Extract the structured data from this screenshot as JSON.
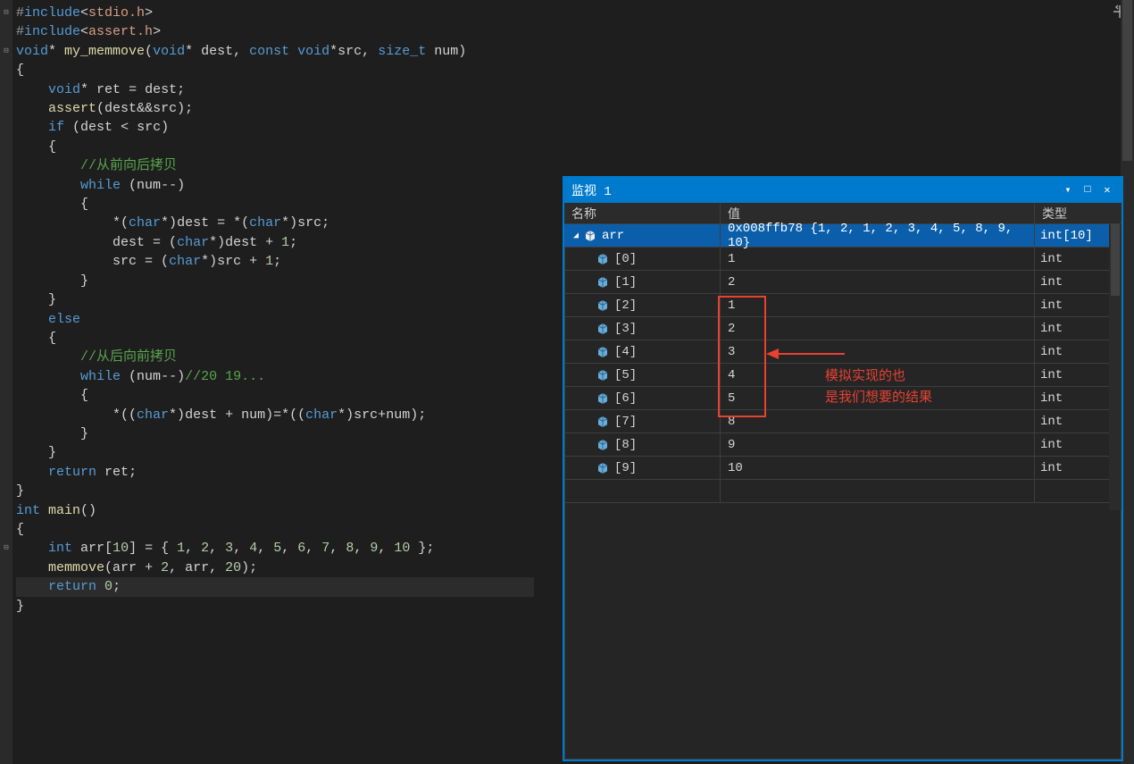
{
  "code_lines": [
    [
      [
        "preproc",
        "#"
      ],
      [
        "kw",
        "include"
      ],
      [
        "op",
        "<"
      ],
      [
        "lib",
        "stdio.h"
      ],
      [
        "op",
        ">"
      ]
    ],
    [
      [
        "preproc",
        "#"
      ],
      [
        "kw",
        "include"
      ],
      [
        "op",
        "<"
      ],
      [
        "lib",
        "assert.h"
      ],
      [
        "op",
        ">"
      ]
    ],
    [
      [
        "kw",
        "void"
      ],
      [
        "op",
        "* "
      ],
      [
        "fn",
        "my_memmove"
      ],
      [
        "op",
        "("
      ],
      [
        "kw",
        "void"
      ],
      [
        "op",
        "* "
      ],
      [
        "id",
        "dest"
      ],
      [
        "op",
        ", "
      ],
      [
        "kw",
        "const void"
      ],
      [
        "op",
        "*"
      ],
      [
        "id",
        "src"
      ],
      [
        "op",
        ", "
      ],
      [
        "kw",
        "size_t"
      ],
      [
        "id",
        " num"
      ],
      [
        "op",
        ")"
      ]
    ],
    [
      [
        "op",
        "{"
      ]
    ],
    [
      [
        "op",
        "    "
      ],
      [
        "kw",
        "void"
      ],
      [
        "op",
        "* "
      ],
      [
        "id",
        "ret"
      ],
      [
        "op",
        " = "
      ],
      [
        "id",
        "dest"
      ],
      [
        "op",
        ";"
      ]
    ],
    [
      [
        "op",
        "    "
      ],
      [
        "fn",
        "assert"
      ],
      [
        "op",
        "("
      ],
      [
        "id",
        "dest"
      ],
      [
        "op",
        "&&"
      ],
      [
        "id",
        "src"
      ],
      [
        "op",
        ");"
      ]
    ],
    [
      [
        "op",
        "    "
      ],
      [
        "kw",
        "if"
      ],
      [
        "op",
        " ("
      ],
      [
        "id",
        "dest"
      ],
      [
        "op",
        " < "
      ],
      [
        "id",
        "src"
      ],
      [
        "op",
        ")"
      ]
    ],
    [
      [
        "op",
        "    {"
      ]
    ],
    [
      [
        "op",
        "        "
      ],
      [
        "cmt",
        "//从前向后拷贝"
      ]
    ],
    [
      [
        "op",
        "        "
      ],
      [
        "kw",
        "while"
      ],
      [
        "op",
        " ("
      ],
      [
        "id",
        "num"
      ],
      [
        "op",
        "--)"
      ]
    ],
    [
      [
        "op",
        "        {"
      ]
    ],
    [
      [
        "op",
        "            *("
      ],
      [
        "kw",
        "char"
      ],
      [
        "op",
        "*)"
      ],
      [
        "id",
        "dest"
      ],
      [
        "op",
        " = *("
      ],
      [
        "kw",
        "char"
      ],
      [
        "op",
        "*)"
      ],
      [
        "id",
        "src"
      ],
      [
        "op",
        ";"
      ]
    ],
    [
      [
        "op",
        "            "
      ],
      [
        "id",
        "dest"
      ],
      [
        "op",
        " = ("
      ],
      [
        "kw",
        "char"
      ],
      [
        "op",
        "*)"
      ],
      [
        "id",
        "dest"
      ],
      [
        "op",
        " + "
      ],
      [
        "num",
        "1"
      ],
      [
        "op",
        ";"
      ]
    ],
    [
      [
        "op",
        "            "
      ],
      [
        "id",
        "src"
      ],
      [
        "op",
        " = ("
      ],
      [
        "kw",
        "char"
      ],
      [
        "op",
        "*)"
      ],
      [
        "id",
        "src"
      ],
      [
        "op",
        " + "
      ],
      [
        "num",
        "1"
      ],
      [
        "op",
        ";"
      ]
    ],
    [
      [
        "op",
        ""
      ]
    ],
    [
      [
        "op",
        "        }"
      ]
    ],
    [
      [
        "op",
        ""
      ]
    ],
    [
      [
        "op",
        "    }"
      ]
    ],
    [
      [
        "op",
        "    "
      ],
      [
        "kw",
        "else"
      ]
    ],
    [
      [
        "op",
        "    {"
      ]
    ],
    [
      [
        "op",
        "        "
      ],
      [
        "cmt",
        "//从后向前拷贝"
      ]
    ],
    [
      [
        "op",
        "        "
      ],
      [
        "kw",
        "while"
      ],
      [
        "op",
        " ("
      ],
      [
        "id",
        "num"
      ],
      [
        "op",
        "--)"
      ],
      [
        "cmt",
        "//20 19..."
      ]
    ],
    [
      [
        "op",
        "        {"
      ]
    ],
    [
      [
        "op",
        "            *(("
      ],
      [
        "kw",
        "char"
      ],
      [
        "op",
        "*)"
      ],
      [
        "id",
        "dest"
      ],
      [
        "op",
        " + "
      ],
      [
        "id",
        "num"
      ],
      [
        "op",
        ")=*(("
      ],
      [
        "kw",
        "char"
      ],
      [
        "op",
        "*)"
      ],
      [
        "id",
        "src"
      ],
      [
        "op",
        "+"
      ],
      [
        "id",
        "num"
      ],
      [
        "op",
        ");"
      ]
    ],
    [
      [
        "op",
        "        }"
      ]
    ],
    [
      [
        "op",
        "    }"
      ]
    ],
    [
      [
        "op",
        "    "
      ],
      [
        "kw",
        "return"
      ],
      [
        "op",
        " "
      ],
      [
        "id",
        "ret"
      ],
      [
        "op",
        ";"
      ]
    ],
    [
      [
        "op",
        "}"
      ]
    ],
    [
      [
        "kw",
        "int"
      ],
      [
        "op",
        " "
      ],
      [
        "fn",
        "main"
      ],
      [
        "op",
        "()"
      ]
    ],
    [
      [
        "op",
        "{"
      ]
    ],
    [
      [
        "op",
        "    "
      ],
      [
        "kw",
        "int"
      ],
      [
        "op",
        " "
      ],
      [
        "id",
        "arr"
      ],
      [
        "op",
        "["
      ],
      [
        "num",
        "10"
      ],
      [
        "op",
        "] = { "
      ],
      [
        "num",
        "1"
      ],
      [
        "op",
        ", "
      ],
      [
        "num",
        "2"
      ],
      [
        "op",
        ", "
      ],
      [
        "num",
        "3"
      ],
      [
        "op",
        ", "
      ],
      [
        "num",
        "4"
      ],
      [
        "op",
        ", "
      ],
      [
        "num",
        "5"
      ],
      [
        "op",
        ", "
      ],
      [
        "num",
        "6"
      ],
      [
        "op",
        ", "
      ],
      [
        "num",
        "7"
      ],
      [
        "op",
        ", "
      ],
      [
        "num",
        "8"
      ],
      [
        "op",
        ", "
      ],
      [
        "num",
        "9"
      ],
      [
        "op",
        ", "
      ],
      [
        "num",
        "10"
      ],
      [
        "op",
        " };"
      ]
    ],
    [
      [
        "op",
        "    "
      ],
      [
        "fn",
        "memmove"
      ],
      [
        "op",
        "("
      ],
      [
        "id",
        "arr"
      ],
      [
        "op",
        " + "
      ],
      [
        "num",
        "2"
      ],
      [
        "op",
        ", "
      ],
      [
        "id",
        "arr"
      ],
      [
        "op",
        ", "
      ],
      [
        "num",
        "20"
      ],
      [
        "op",
        ");"
      ]
    ],
    [
      [
        "op",
        "    "
      ],
      [
        "kw",
        "return"
      ],
      [
        "op",
        " "
      ],
      [
        "num",
        "0"
      ],
      [
        "op",
        ";"
      ]
    ],
    [
      [
        "op",
        "}"
      ]
    ]
  ],
  "highlight_line_index": 32,
  "fold_markers": [
    0,
    2,
    28
  ],
  "watch": {
    "title": "监视 1",
    "columns": {
      "name": "名称",
      "value": "值",
      "type": "类型"
    },
    "root": {
      "name": "arr",
      "value": "0x008ffb78 {1, 2, 1, 2, 3, 4, 5, 8, 9, 10}",
      "type": "int[10]"
    },
    "rows": [
      {
        "idx": "[0]",
        "value": "1",
        "type": "int"
      },
      {
        "idx": "[1]",
        "value": "2",
        "type": "int"
      },
      {
        "idx": "[2]",
        "value": "1",
        "type": "int"
      },
      {
        "idx": "[3]",
        "value": "2",
        "type": "int"
      },
      {
        "idx": "[4]",
        "value": "3",
        "type": "int"
      },
      {
        "idx": "[5]",
        "value": "4",
        "type": "int"
      },
      {
        "idx": "[6]",
        "value": "5",
        "type": "int"
      },
      {
        "idx": "[7]",
        "value": "8",
        "type": "int"
      },
      {
        "idx": "[8]",
        "value": "9",
        "type": "int"
      },
      {
        "idx": "[9]",
        "value": "10",
        "type": "int"
      }
    ]
  },
  "annotation": {
    "line1": "模拟实现的也",
    "line2": "是我们想要的结果"
  }
}
